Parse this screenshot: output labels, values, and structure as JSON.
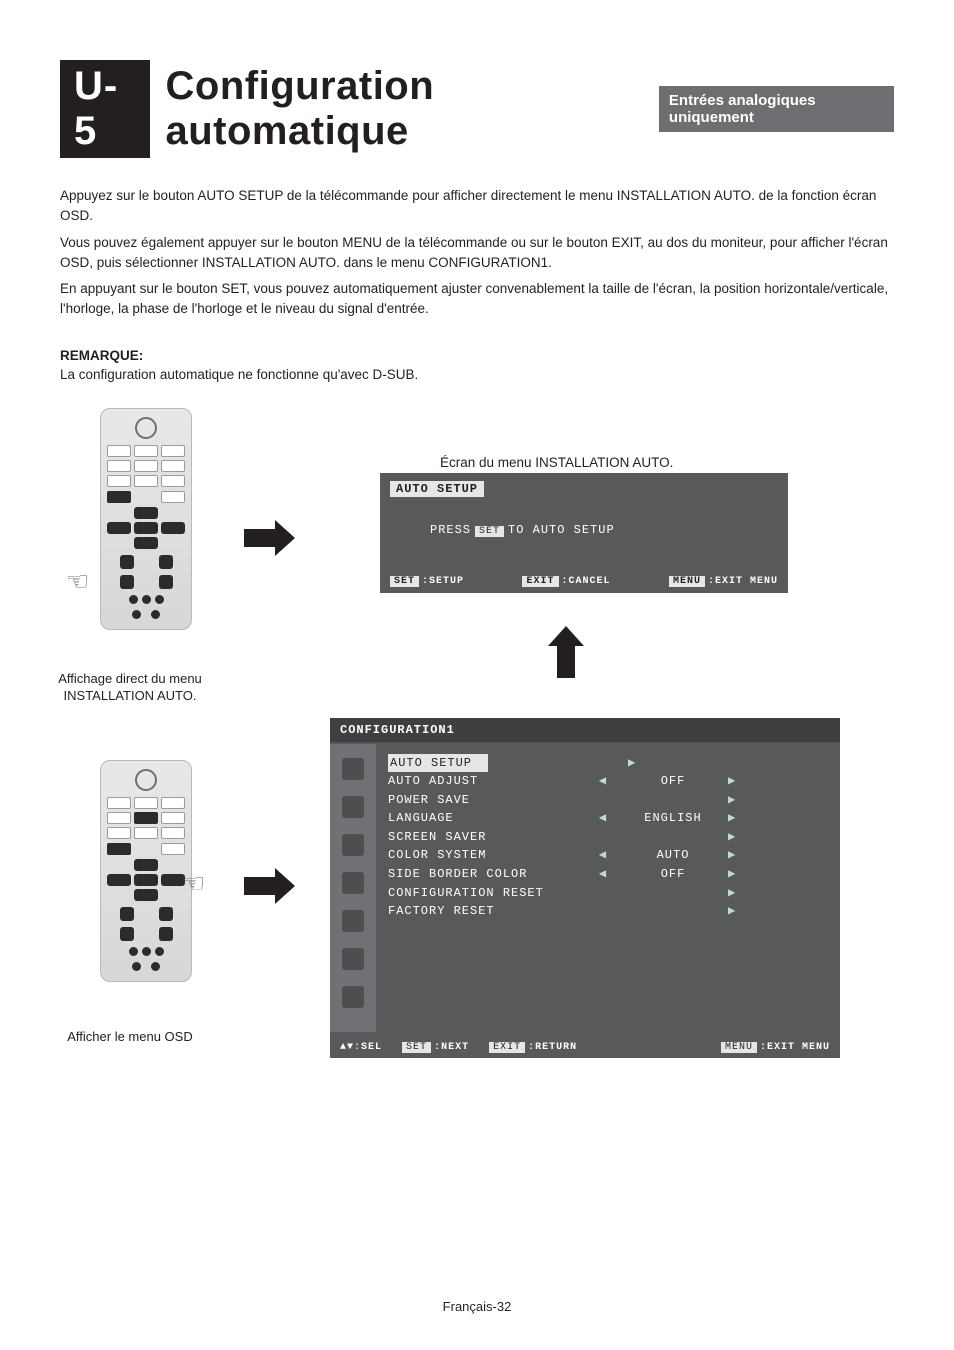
{
  "header": {
    "chip": "U-5",
    "title": "Configuration automatique",
    "badge": "Entrées analogiques uniquement"
  },
  "body": {
    "p1": "Appuyez sur le bouton AUTO SETUP de la télécommande pour afficher directement le menu INSTALLATION AUTO. de la fonction écran OSD.",
    "p2": "Vous pouvez également appuyer sur le bouton MENU de la télécommande ou sur le bouton EXIT, au dos du moniteur, pour afficher l'écran OSD, puis sélectionner INSTALLATION AUTO. dans le menu CONFIGURATION1.",
    "p3": "En appuyant sur le bouton SET, vous pouvez automatiquement ajuster convenablement la taille de l'écran, la position horizontale/verticale, l'horloge, la phase de l'horloge et le niveau du signal d'entrée."
  },
  "note": {
    "heading": "REMARQUE:",
    "body": "La configuration automatique ne fonctionne qu'avec D-SUB."
  },
  "captions": {
    "remote1": "Affichage direct du menu INSTALLATION AUTO.",
    "remote2": "Afficher le menu OSD"
  },
  "osd1": {
    "caption": "Écran du menu INSTALLATION AUTO.",
    "title": "AUTO SETUP",
    "prompt_pre": "PRESS",
    "prompt_tag": "SET",
    "prompt_post": "TO AUTO SETUP",
    "footer": [
      {
        "tag": "SET",
        "txt": ":SETUP"
      },
      {
        "tag": "EXIT",
        "txt": ":CANCEL"
      },
      {
        "tag": "MENU",
        "txt": ":EXIT MENU"
      }
    ]
  },
  "osd2": {
    "title": "CONFIGURATION1",
    "rows": [
      {
        "label": "AUTO SETUP",
        "hl": true,
        "left": "",
        "right": "▶",
        "value": ""
      },
      {
        "label": "AUTO ADJUST",
        "left": "◀",
        "right": "▶",
        "value": "OFF"
      },
      {
        "label": "POWER SAVE",
        "left": "",
        "right": "▶",
        "value": ""
      },
      {
        "label": "LANGUAGE",
        "left": "◀",
        "right": "▶",
        "value": "ENGLISH"
      },
      {
        "label": "SCREEN SAVER",
        "left": "",
        "right": "▶",
        "value": ""
      },
      {
        "label": "COLOR SYSTEM",
        "left": "◀",
        "right": "▶",
        "value": "AUTO"
      },
      {
        "label": "SIDE BORDER COLOR",
        "left": "◀",
        "right": "▶",
        "value": "OFF"
      },
      {
        "label": "CONFIGURATION RESET",
        "left": "",
        "right": "▶",
        "value": ""
      },
      {
        "label": "FACTORY RESET",
        "left": "",
        "right": "▶",
        "value": ""
      }
    ],
    "footer": {
      "sel": "SEL",
      "next_tag": "SET",
      "next": ":NEXT",
      "return_tag": "EXIT",
      "return": ":RETURN",
      "exit_tag": "MENU",
      "exit": ":EXIT MENU"
    }
  },
  "footer": {
    "page": "Français-32"
  }
}
